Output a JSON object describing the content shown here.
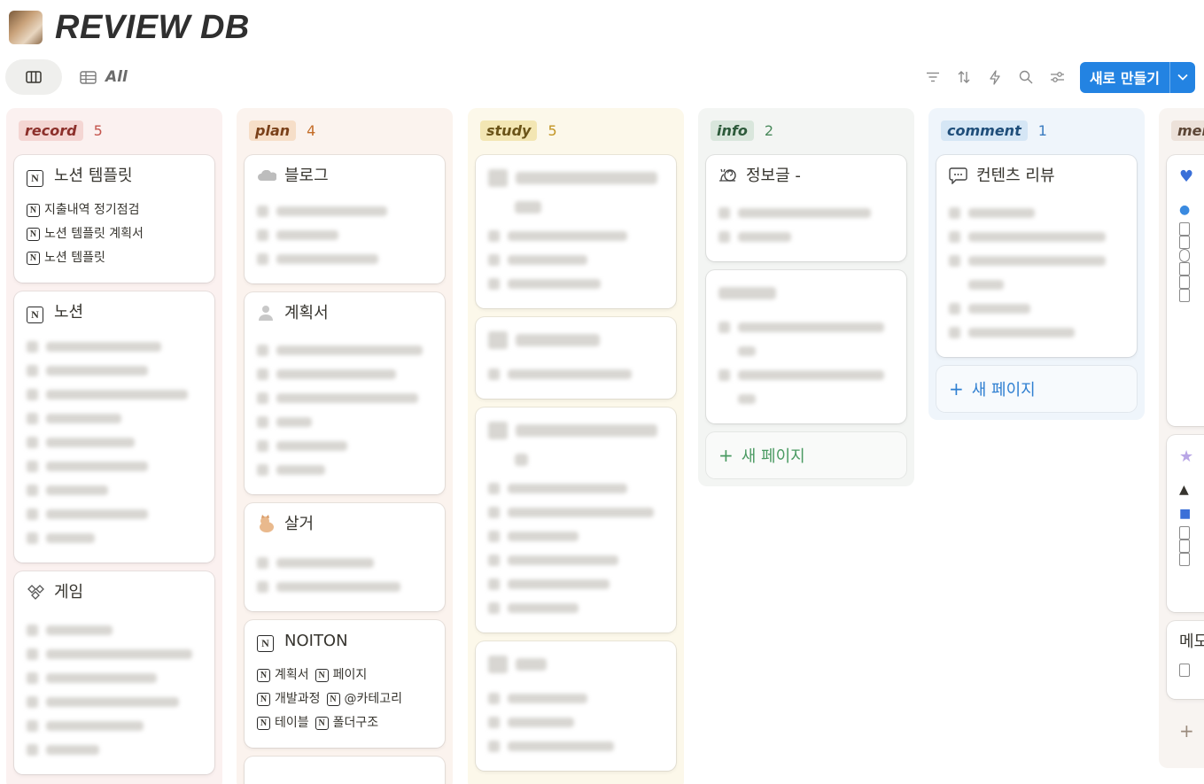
{
  "page": {
    "title": "REVIEW DB",
    "icon": "photo-icon"
  },
  "views": {
    "board_icon": "board-view-icon",
    "table_tab_label": "All"
  },
  "toolbar": {
    "new_label": "새로 만들기"
  },
  "columns": [
    {
      "tag": "record",
      "count": "5",
      "tag_color": "#f4d6d3",
      "tag_text": "#8c2f2a",
      "count_color": "#c4554d",
      "bg": "#fbf1f0",
      "cards": [
        {
          "title": "노션 템플릿",
          "icon": "notion-icon",
          "relations": [
            "지출내역 정기점검",
            "노션 템플릿 계획서",
            "노션 템플릿"
          ]
        },
        {
          "title": "노션",
          "icon": "notion-icon"
        },
        {
          "title": "게임",
          "icon": "game-icon"
        }
      ]
    },
    {
      "tag": "plan",
      "count": "4",
      "tag_color": "#f6dec8",
      "tag_text": "#7a4019",
      "count_color": "#c46d28",
      "bg": "#fbf3ee",
      "cards": [
        {
          "title": "블로그",
          "icon": "cloud-icon"
        },
        {
          "title": "계획서",
          "icon": "user-icon"
        },
        {
          "title": "살거",
          "icon": "cat-icon"
        },
        {
          "title": "NOITON",
          "icon": "notion-icon",
          "relations": [
            "계획서",
            "페이지",
            "개발과정",
            "@카테고리",
            "테이블",
            "폴더구조"
          ]
        }
      ]
    },
    {
      "tag": "study",
      "count": "5",
      "tag_color": "#f3e6b3",
      "tag_text": "#6b5418",
      "count_color": "#c29524",
      "bg": "#fcf8ea",
      "cards": [
        {
          "title": ""
        },
        {
          "title": ""
        },
        {
          "title": ""
        },
        {
          "title": ""
        }
      ]
    },
    {
      "tag": "info",
      "count": "2",
      "tag_color": "#d9e6dc",
      "tag_text": "#2c5a3a",
      "count_color": "#4a8a5c",
      "bg": "#f3f5f3",
      "cards": [
        {
          "title": "정보글 -",
          "icon": "snail-icon"
        },
        {
          "title": ""
        }
      ],
      "new_page": "새 페이지",
      "new_color": "#4a9a62"
    },
    {
      "tag": "comment",
      "count": "1",
      "tag_color": "#d5e6f5",
      "tag_text": "#1f4e7a",
      "count_color": "#3a7bc0",
      "bg": "#eff5fb",
      "cards": [
        {
          "title": "컨텐츠 리뷰",
          "icon": "chat-icon"
        }
      ],
      "new_page": "새 페이지",
      "new_color": "#2f7fd1"
    },
    {
      "tag": "mer",
      "count": "",
      "tag_color": "#ece1d9",
      "tag_text": "#5c4636",
      "count_color": "#8a6d57",
      "bg": "#f8f4f1",
      "cards": [
        {
          "title": ""
        },
        {
          "title": ""
        },
        {
          "title": "메모"
        }
      ]
    }
  ]
}
